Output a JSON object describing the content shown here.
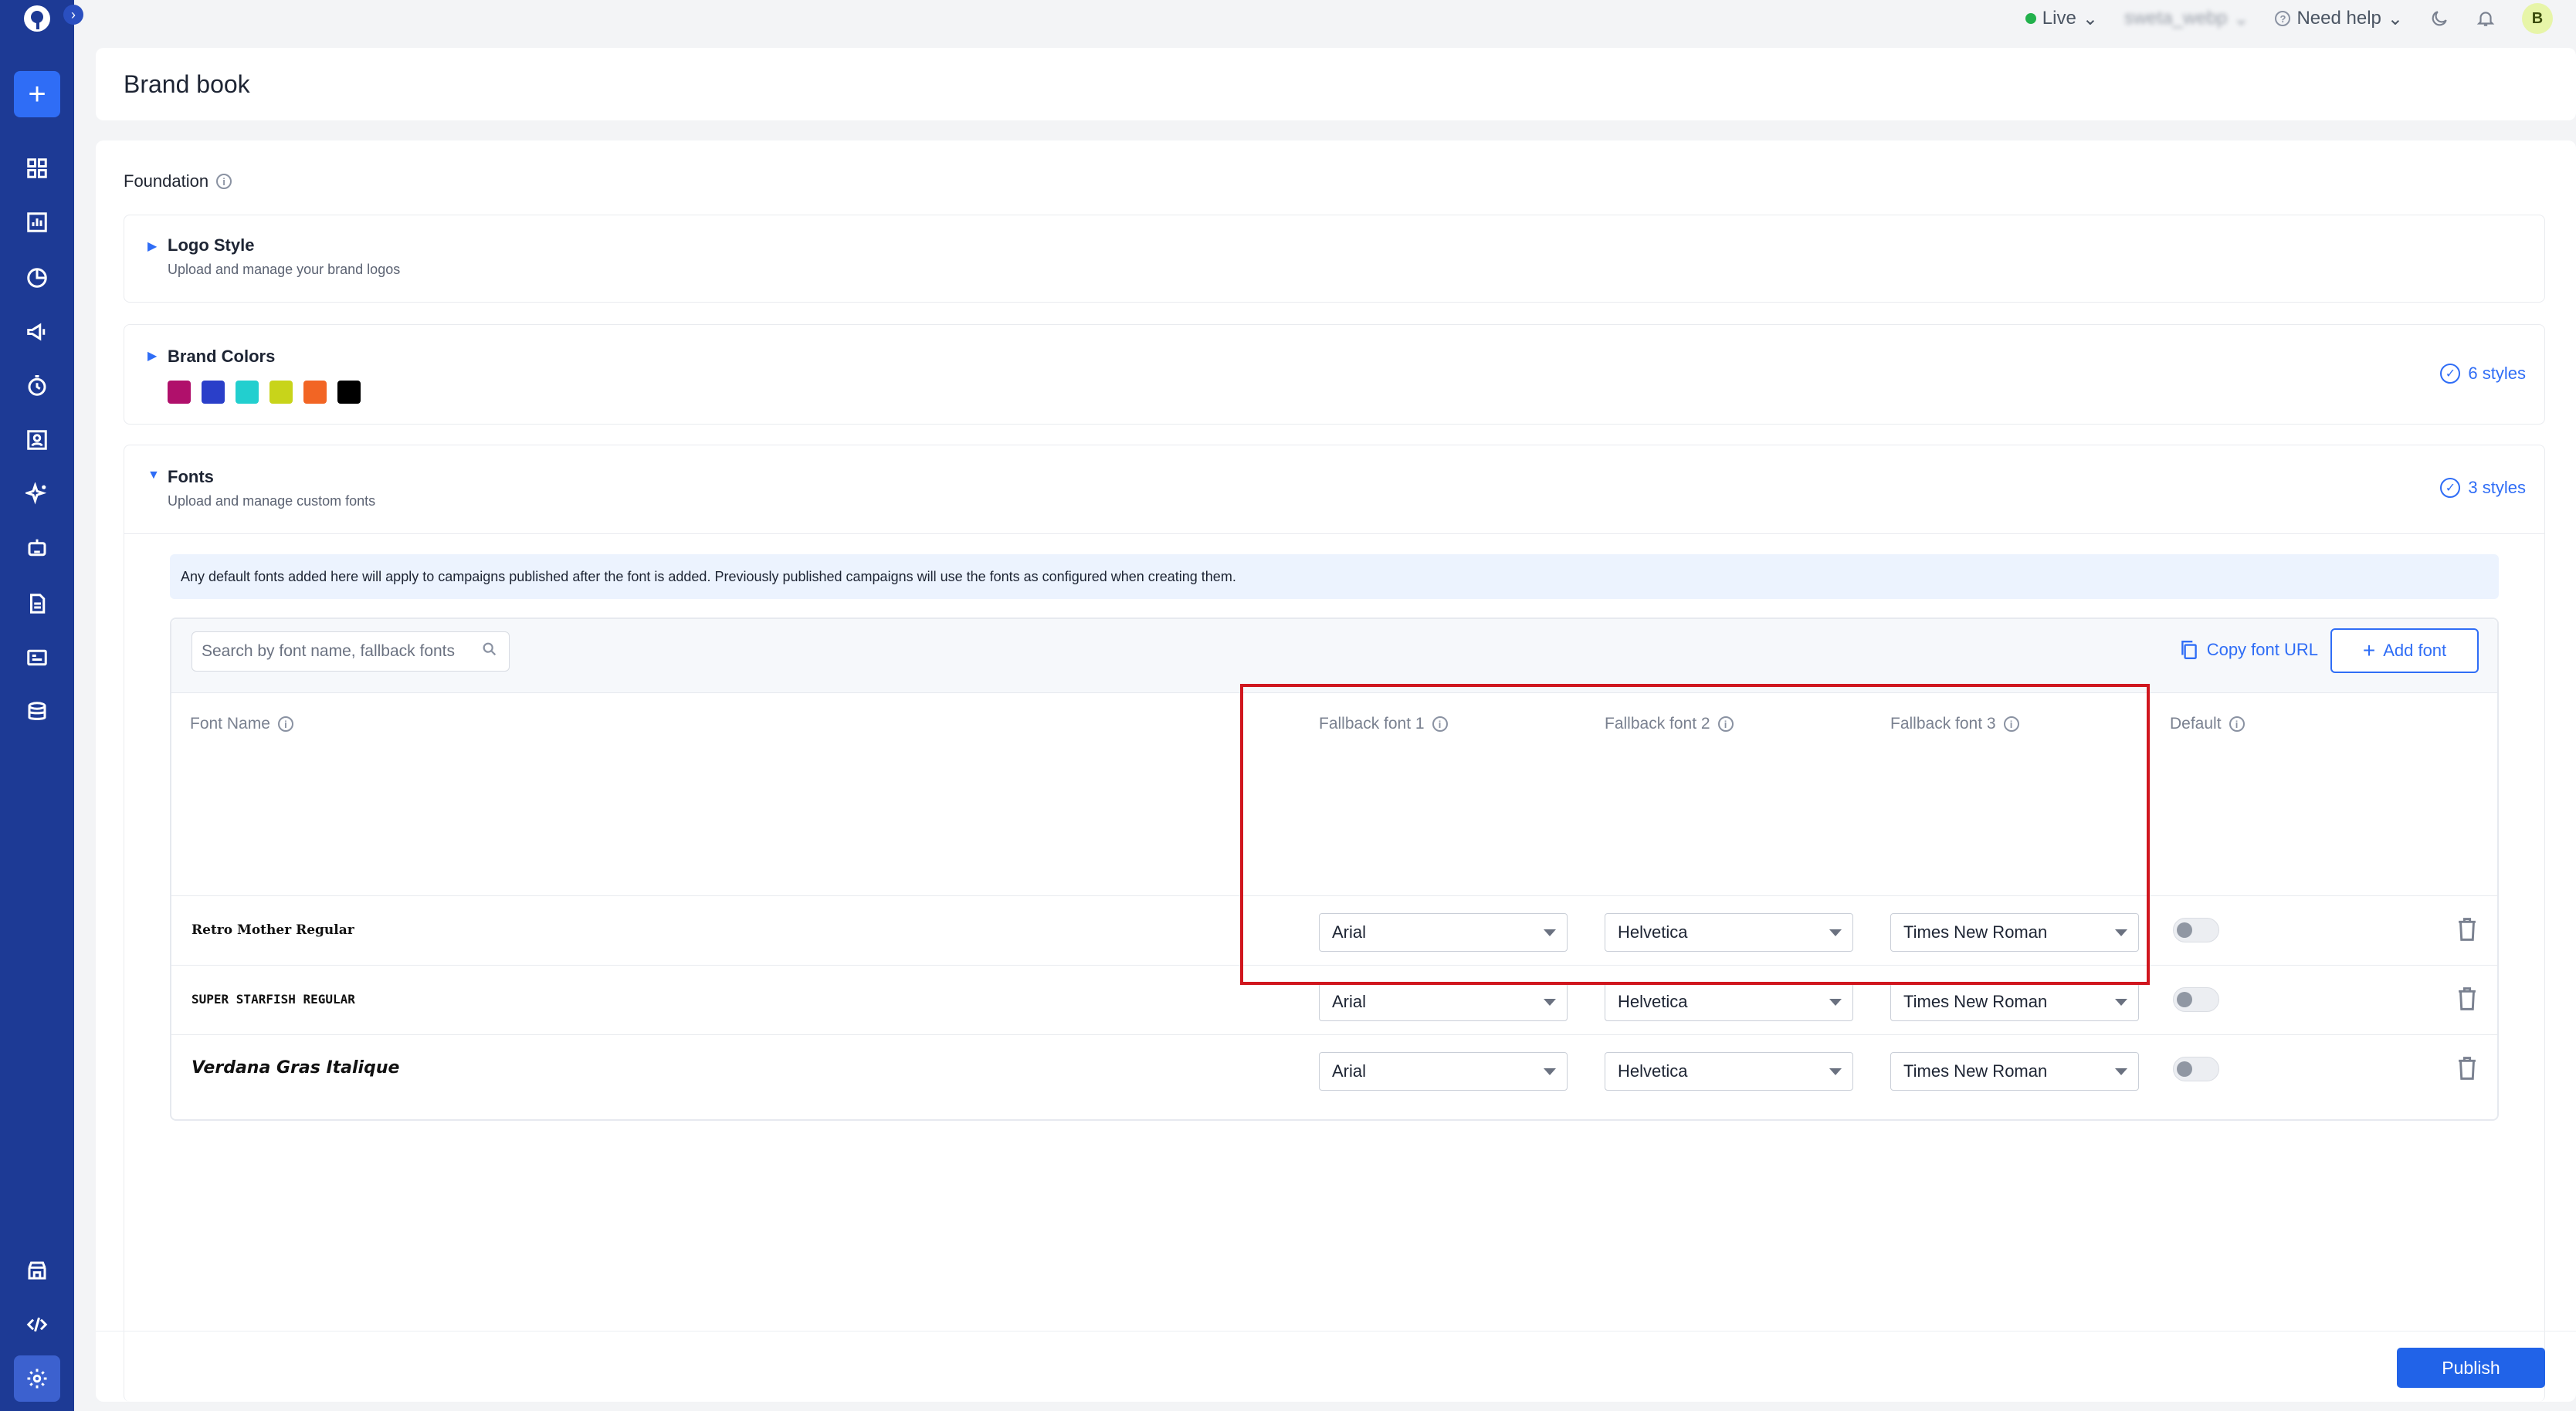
{
  "topbar": {
    "live_label": "Live",
    "account_label": "sweta_webp",
    "help_label": "Need help",
    "avatar_initial": "B"
  },
  "header": {
    "title": "Brand book"
  },
  "foundation": {
    "label": "Foundation"
  },
  "logo_style": {
    "title": "Logo Style",
    "subtitle": "Upload and manage your brand logos"
  },
  "brand_colors": {
    "title": "Brand Colors",
    "styles_count": "6 styles",
    "swatches": [
      "#b0106b",
      "#2a3fc9",
      "#22cfcf",
      "#c8d41a",
      "#f26524",
      "#000000"
    ]
  },
  "fonts": {
    "title": "Fonts",
    "subtitle": "Upload and manage custom fonts",
    "styles_count": "3 styles",
    "notice": "Any default fonts added here will apply to campaigns published after the font is added. Previously published campaigns will use the fonts as configured when creating them.",
    "search_placeholder": "Search by font name, fallback fonts",
    "copy_url_label": "Copy font URL",
    "add_font_label": "Add font",
    "columns": {
      "font_name": "Font Name",
      "fallback1": "Fallback font 1",
      "fallback2": "Fallback font 2",
      "fallback3": "Fallback font 3",
      "default": "Default"
    },
    "rows": [
      {
        "name": "Retro Mother Regular",
        "fallback1": "Arial",
        "fallback2": "Helvetica",
        "fallback3": "Times New Roman",
        "default": false
      },
      {
        "name": "Super Starfish Regular",
        "fallback1": "Arial",
        "fallback2": "Helvetica",
        "fallback3": "Times New Roman",
        "default": false
      },
      {
        "name": "Verdana Gras Italique",
        "fallback1": "Arial",
        "fallback2": "Helvetica",
        "fallback3": "Times New Roman",
        "default": false
      }
    ]
  },
  "footer": {
    "publish_label": "Publish"
  },
  "colors": {
    "sidebar": "#1d3a95",
    "accent": "#2f6df6",
    "highlight": "#d0161e"
  }
}
